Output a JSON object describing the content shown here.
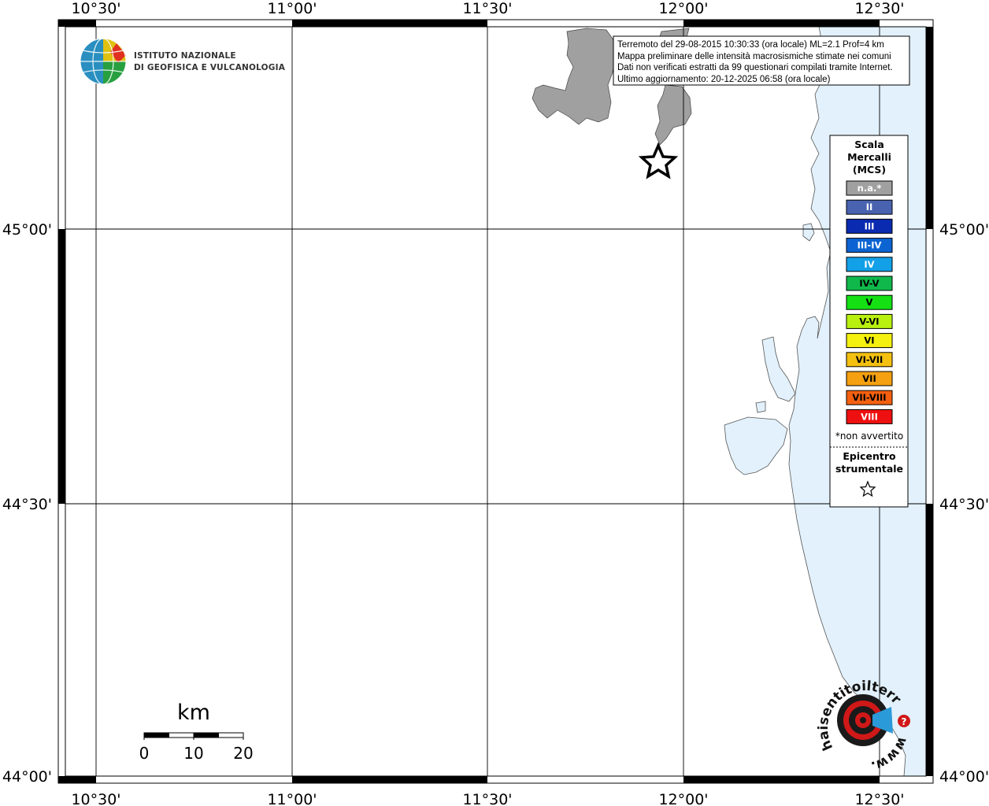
{
  "map": {
    "lon_labels": [
      "10°30'",
      "11°00'",
      "11°30'",
      "12°00'",
      "12°30'"
    ],
    "lat_labels": [
      "45°00'",
      "44°30'",
      "44°00'"
    ],
    "info_box": {
      "lines": [
        "Terremoto del 29-08-2015 10:30:33 (ora locale) ML=2.1 Prof=4 km",
        "Mappa preliminare delle intensità macrosismiche stimate nei comuni",
        "Dati non verificati estratti da 99 questionari compilati tramite Internet.",
        "Ultimo aggiornamento: 20-12-2025 06:58 (ora locale)"
      ]
    },
    "institute_logo": {
      "line1": "ISTITUTO NAZIONALE",
      "line2": "DI GEOFISICA E VULCANOLOGIA"
    },
    "legend": {
      "title_lines": [
        "Scala",
        "Mercalli",
        "(MCS)"
      ],
      "items": [
        {
          "label": "n.a.*",
          "color": "#a0a0a0",
          "text_color": "#ffffff"
        },
        {
          "label": "II",
          "color": "#4a63b0",
          "text_color": "#ffffff"
        },
        {
          "label": "III",
          "color": "#0a2ab0",
          "text_color": "#ffffff"
        },
        {
          "label": "III-IV",
          "color": "#0c64d2",
          "text_color": "#ffffff"
        },
        {
          "label": "IV",
          "color": "#12a0e8",
          "text_color": "#ffffff"
        },
        {
          "label": "IV-V",
          "color": "#10b84c",
          "text_color": "#000000"
        },
        {
          "label": "V",
          "color": "#14e014",
          "text_color": "#000000"
        },
        {
          "label": "V-VI",
          "color": "#b8f010",
          "text_color": "#000000"
        },
        {
          "label": "VI",
          "color": "#f4f010",
          "text_color": "#000000"
        },
        {
          "label": "VI-VII",
          "color": "#f4c010",
          "text_color": "#000000"
        },
        {
          "label": "VII",
          "color": "#f4a010",
          "text_color": "#000000"
        },
        {
          "label": "VII-VIII",
          "color": "#f46010",
          "text_color": "#000000"
        },
        {
          "label": "VIII",
          "color": "#ee1010",
          "text_color": "#ffffff"
        }
      ],
      "note": "*non avvertito",
      "epicenter_lines": [
        "Epicentro",
        "strumentale"
      ]
    },
    "scale_bar": {
      "unit": "km",
      "ticks": [
        "0",
        "10",
        "20"
      ]
    },
    "hsit_logo": {
      "arc_text": "haisentitoilterremoto.it",
      "www": "www."
    },
    "colors": {
      "sea": "#e2f1fc",
      "affected_area": "#a0a0a0",
      "frame": "#000000"
    }
  }
}
